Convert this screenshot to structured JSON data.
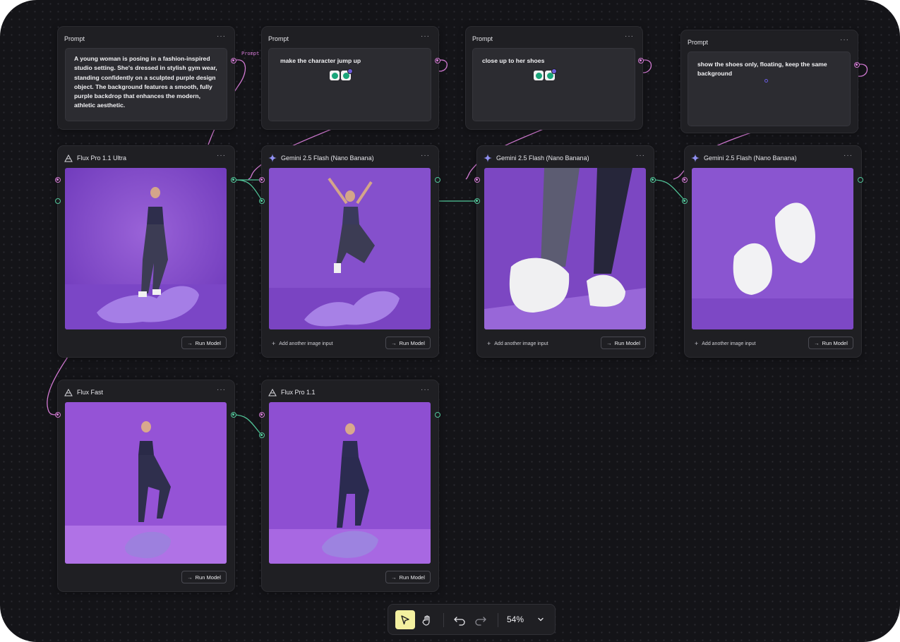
{
  "app": {
    "accent_pink": "#d27ad3",
    "accent_green": "#52c79a",
    "canvas_bg": "#141418"
  },
  "prompts": [
    {
      "title": "Prompt",
      "menu": "···",
      "text": "A young woman is posing in a fashion-inspired studio setting. She's dressed in stylish gym wear, standing confidently on a sculpted purple design object. The background features a smooth, fully purple backdrop that enhances the modern, athletic aesthetic."
    },
    {
      "title": "Prompt",
      "menu": "···",
      "text": "make the character  jump up"
    },
    {
      "title": "Prompt",
      "menu": "···",
      "text": "close up to her shoes"
    },
    {
      "title": "Prompt",
      "menu": "···",
      "text": "show the shoes only, floating, keep the same background"
    }
  ],
  "wire_label": "Prompt",
  "models": [
    {
      "title": "Flux Pro 1.1 Ultra",
      "icon": "flux-icon",
      "menu": "···",
      "run": "Run Model",
      "image": "woman-posing-on-purple-sculpture",
      "add_input": ""
    },
    {
      "title": "Gemini 2.5 Flash (Nano Banana)",
      "icon": "gemini-sparkle-icon",
      "menu": "···",
      "run": "Run Model",
      "image": "woman-jumping-on-purple-backdrop",
      "add_input": "Add another image input"
    },
    {
      "title": "Gemini 2.5 Flash (Nano Banana)",
      "icon": "gemini-sparkle-icon",
      "menu": "···",
      "run": "Run Model",
      "image": "close-up-of-white-sneakers",
      "add_input": "Add another image input"
    },
    {
      "title": "Gemini 2.5 Flash (Nano Banana)",
      "icon": "gemini-sparkle-icon",
      "menu": "···",
      "run": "Run Model",
      "image": "floating-white-sneakers",
      "add_input": "Add another image input"
    },
    {
      "title": "Flux Fast",
      "icon": "flux-icon",
      "menu": "···",
      "run": "Run Model",
      "image": "woman-standing-on-purple-blob",
      "add_input": ""
    },
    {
      "title": "Flux Pro 1.1",
      "icon": "flux-icon",
      "menu": "···",
      "run": "Run Model",
      "image": "woman-standing-on-purple-blob-2",
      "add_input": ""
    }
  ],
  "toolbar": {
    "zoom": "54%",
    "tools": [
      "select-pointer-icon",
      "hand-pan-icon",
      "undo-icon",
      "redo-icon",
      "chevron-down-icon"
    ]
  }
}
